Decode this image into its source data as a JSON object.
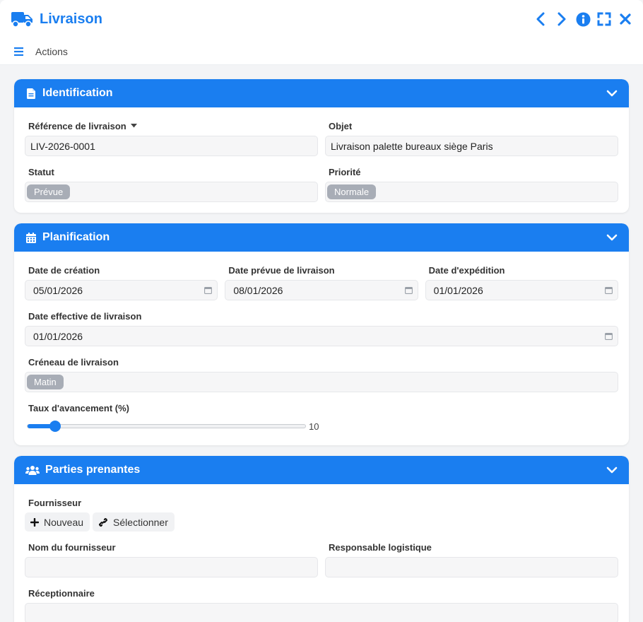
{
  "window": {
    "title": "Livraison",
    "icon": "truck-icon",
    "accent": "#1a7ef0"
  },
  "toolbar": {
    "actions_label": "Actions"
  },
  "sections": {
    "identification": {
      "title": "Identification",
      "reference_label": "Référence de livraison",
      "reference_value": "LIV-2026-0001",
      "objet_label": "Objet",
      "objet_value": "Livraison palette bureaux siège Paris",
      "statut_label": "Statut",
      "statut_value": "Prévue",
      "priorite_label": "Priorité",
      "priorite_value": "Normale"
    },
    "planification": {
      "title": "Planification",
      "date_creation_label": "Date de création",
      "date_creation_value": "05/01/2026",
      "date_prevue_label": "Date prévue de livraison",
      "date_prevue_value": "08/01/2026",
      "date_expedition_label": "Date d'expédition",
      "date_expedition_value": "01/01/2026",
      "date_effective_label": "Date effective de livraison",
      "date_effective_value": "01/01/2026",
      "creneau_label": "Créneau de livraison",
      "creneau_value": "Matin",
      "taux_label": "Taux d'avancement (%)",
      "taux_value": "10",
      "taux_percent": 10
    },
    "parties": {
      "title": "Parties prenantes",
      "fournisseur_label": "Fournisseur",
      "nouveau_label": "Nouveau",
      "selectionner_label": "Sélectionner",
      "nom_fournisseur_label": "Nom du fournisseur",
      "nom_fournisseur_value": "",
      "responsable_label": "Responsable logistique",
      "responsable_value": "",
      "receptionnaire_label": "Réceptionnaire",
      "receptionnaire_value": ""
    }
  }
}
